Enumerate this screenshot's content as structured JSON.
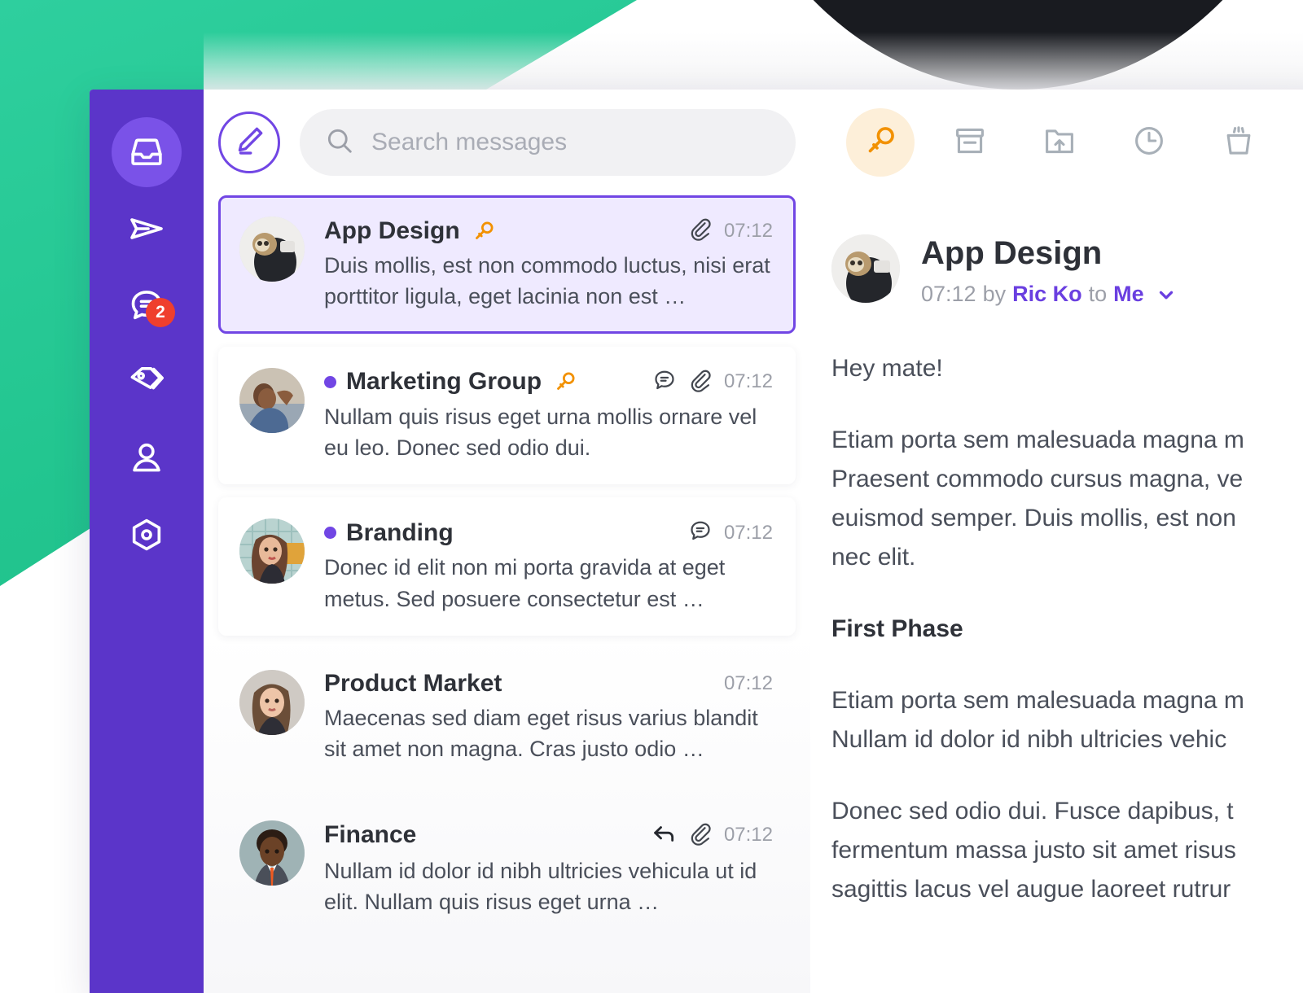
{
  "background": {
    "green_color": "#22c58f",
    "dark_color": "#191b20"
  },
  "theme": {
    "purple": "#5b35c9",
    "purple_accent": "#7146e4",
    "orange": "#f29100",
    "badge_red": "#ef3f2d"
  },
  "sidebar": {
    "items": [
      {
        "name": "inbox",
        "icon": "inbox-icon",
        "active": true,
        "badge": null
      },
      {
        "name": "sent",
        "icon": "send-icon",
        "active": false,
        "badge": null
      },
      {
        "name": "chats",
        "icon": "chat-icon",
        "active": false,
        "badge": "2"
      },
      {
        "name": "tags",
        "icon": "tag-icon",
        "active": false,
        "badge": null
      },
      {
        "name": "contacts",
        "icon": "user-icon",
        "active": false,
        "badge": null
      },
      {
        "name": "settings",
        "icon": "settings-icon",
        "active": false,
        "badge": null
      }
    ]
  },
  "list_toolbar": {
    "compose_label": "compose-icon",
    "search": {
      "placeholder": "Search messages",
      "value": ""
    }
  },
  "detail_toolbar": {
    "buttons": [
      {
        "name": "key",
        "icon": "key-icon",
        "active": true
      },
      {
        "name": "archive",
        "icon": "archive-icon",
        "active": false
      },
      {
        "name": "move",
        "icon": "folder-upload-icon",
        "active": false
      },
      {
        "name": "snooze",
        "icon": "clock-icon",
        "active": false
      },
      {
        "name": "delete",
        "icon": "trash-icon",
        "active": false
      }
    ]
  },
  "message_list": [
    {
      "title": "App Design",
      "preview": "Duis mollis, est non commodo luctus, nisi erat porttitor ligula, eget lacinia non est …",
      "time": "07:12",
      "selected": true,
      "unread_dot": false,
      "has_key": true,
      "has_comment": false,
      "has_attachment": true,
      "has_reply": false
    },
    {
      "title": "Marketing Group",
      "preview": "Nullam quis risus eget urna mollis ornare vel eu leo. Donec sed odio dui.",
      "time": "07:12",
      "selected": false,
      "unread_dot": true,
      "has_key": true,
      "has_comment": true,
      "has_attachment": true,
      "has_reply": false
    },
    {
      "title": "Branding",
      "preview": "Donec id elit non mi porta gravida at eget metus. Sed posuere consectetur est …",
      "time": "07:12",
      "selected": false,
      "unread_dot": true,
      "has_key": false,
      "has_comment": true,
      "has_attachment": false,
      "has_reply": false
    },
    {
      "title": "Product Market",
      "preview": "Maecenas sed diam eget risus varius blandit sit amet non magna. Cras justo odio …",
      "time": "07:12",
      "selected": false,
      "unread_dot": false,
      "has_key": false,
      "has_comment": false,
      "has_attachment": false,
      "has_reply": false
    },
    {
      "title": "Finance",
      "preview": "Nullam id dolor id nibh ultricies vehicula ut id elit. Nullam quis risus eget urna …",
      "time": "07:12",
      "selected": false,
      "unread_dot": false,
      "has_key": false,
      "has_comment": false,
      "has_attachment": true,
      "has_reply": true
    }
  ],
  "detail": {
    "title": "App Design",
    "time": "07:12",
    "by_label": "by",
    "sender": "Ric Ko",
    "to_label": "to",
    "recipient": "Me",
    "body": {
      "greeting": "Hey mate!",
      "p1_l1": "Etiam porta sem malesuada magna m",
      "p1_l2": "Praesent commodo cursus magna, ve",
      "p1_l3": "euismod semper. Duis mollis, est non",
      "p1_l4": "nec elit.",
      "heading": "First Phase",
      "p2_l1": "Etiam porta sem malesuada magna m",
      "p2_l2": "Nullam id dolor id nibh ultricies vehic",
      "p3_l1": "Donec sed odio dui. Fusce dapibus, t",
      "p3_l2": "fermentum massa justo sit amet risus",
      "p3_l3": "sagittis lacus vel augue laoreet rutrur"
    }
  }
}
